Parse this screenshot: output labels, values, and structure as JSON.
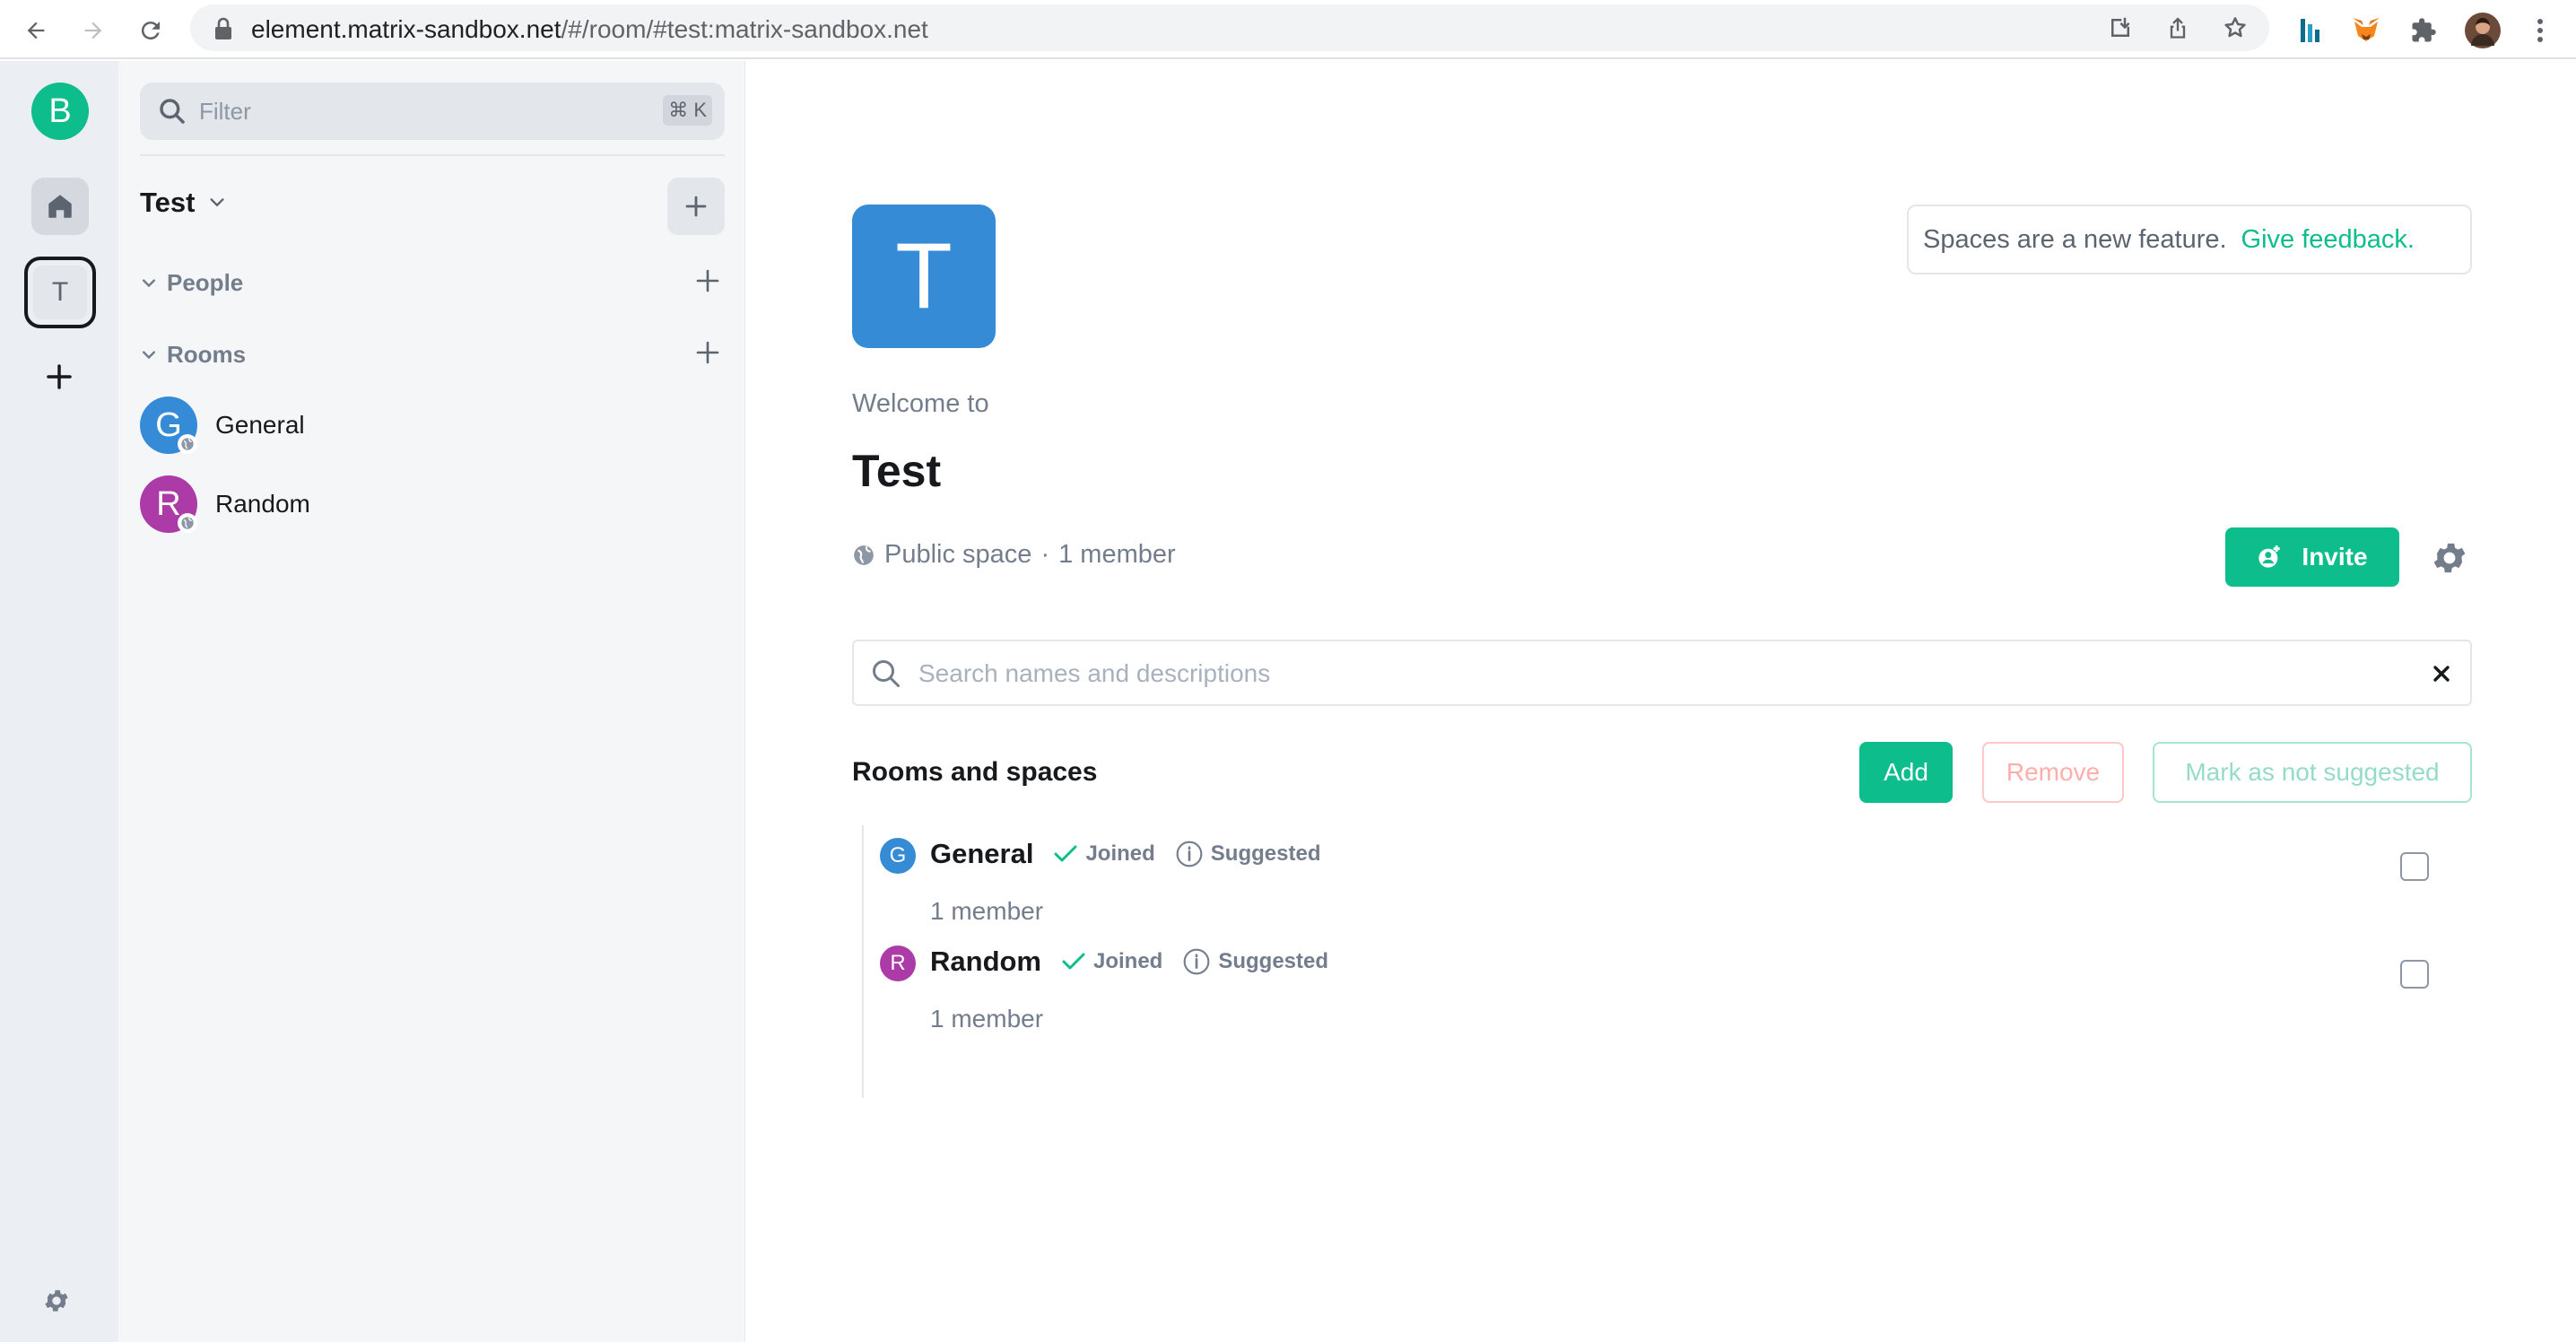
{
  "browser": {
    "url_domain": "element.matrix-sandbox.net",
    "url_path": "/#/room/#test:matrix-sandbox.net"
  },
  "spaces_panel": {
    "user_initial": "B",
    "space_initial": "T"
  },
  "room_list": {
    "filter_placeholder": "Filter",
    "filter_shortcut": "⌘ K",
    "space_name": "Test",
    "sections": {
      "people": "People",
      "rooms": "Rooms"
    },
    "rooms": [
      {
        "initial": "G",
        "name": "General",
        "color": "#368bd6"
      },
      {
        "initial": "R",
        "name": "Random",
        "color": "#ac3ba8"
      }
    ]
  },
  "main": {
    "space_avatar_initial": "T",
    "welcome_label": "Welcome to",
    "space_title": "Test",
    "space_meta": "Public space",
    "member_count": "1 member",
    "feedback_text": "Spaces are a new feature.",
    "feedback_link": "Give feedback.",
    "invite_label": "Invite",
    "search_placeholder": "Search names and descriptions",
    "section_title": "Rooms and spaces",
    "add_label": "Add",
    "remove_label": "Remove",
    "mark_label": "Mark as not suggested",
    "hierarchy": [
      {
        "initial": "G",
        "name": "General",
        "color": "#368bd6",
        "joined": "Joined",
        "suggested": "Suggested",
        "members": "1 member"
      },
      {
        "initial": "R",
        "name": "Random",
        "color": "#ac3ba8",
        "joined": "Joined",
        "suggested": "Suggested",
        "members": "1 member"
      }
    ]
  },
  "colors": {
    "accent": "#0dbd8b",
    "remove": "#ff5b55",
    "space_avatar": "#368bd6"
  }
}
